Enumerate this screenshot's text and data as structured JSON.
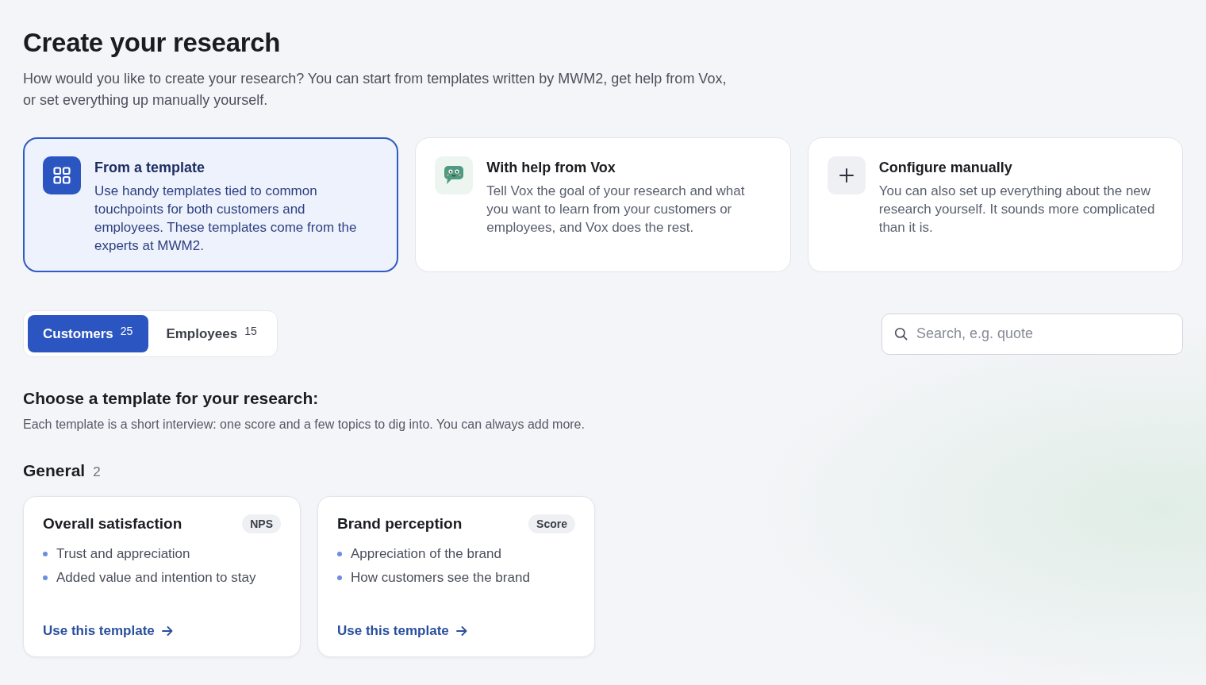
{
  "page": {
    "title": "Create your research",
    "intro": "How would you like to create your research? You can start from templates written by MWM2, get help from Vox, or set everything up manually yourself."
  },
  "options": [
    {
      "kind": "template",
      "title": "From a template",
      "description": "Use handy templates tied to common touchpoints for both customers and employees. These templates come from the experts at MWM2.",
      "selected": true
    },
    {
      "kind": "assistant",
      "title": "With help from Vox",
      "description": "Tell Vox the goal of your research and what you want to learn from your customers or employees, and Vox does the rest.",
      "selected": false
    },
    {
      "kind": "manual",
      "title": "Configure manually",
      "description": "You can also set up everything about the new research yourself. It sounds more complicated than it is.",
      "selected": false
    }
  ],
  "audience_tabs": [
    {
      "label": "Customers",
      "count": "25",
      "selected": true
    },
    {
      "label": "Employees",
      "count": "15",
      "selected": false
    }
  ],
  "search": {
    "placeholder": "Search, e.g. quote"
  },
  "templates_section": {
    "title": "Choose a template for your research:",
    "description": "Each template is a short interview: one score and a few topics to dig into. You can always add more."
  },
  "groups": [
    {
      "name": "General",
      "count": "2",
      "templates": [
        {
          "title": "Overall satisfaction",
          "tag": "NPS",
          "topics": [
            "Trust and appreciation",
            "Added value and intention to stay"
          ],
          "action": "Use this template"
        },
        {
          "title": "Brand perception",
          "tag": "Score",
          "topics": [
            "Appreciation of the brand",
            "How customers see the brand"
          ],
          "action": "Use this template"
        }
      ]
    }
  ]
}
